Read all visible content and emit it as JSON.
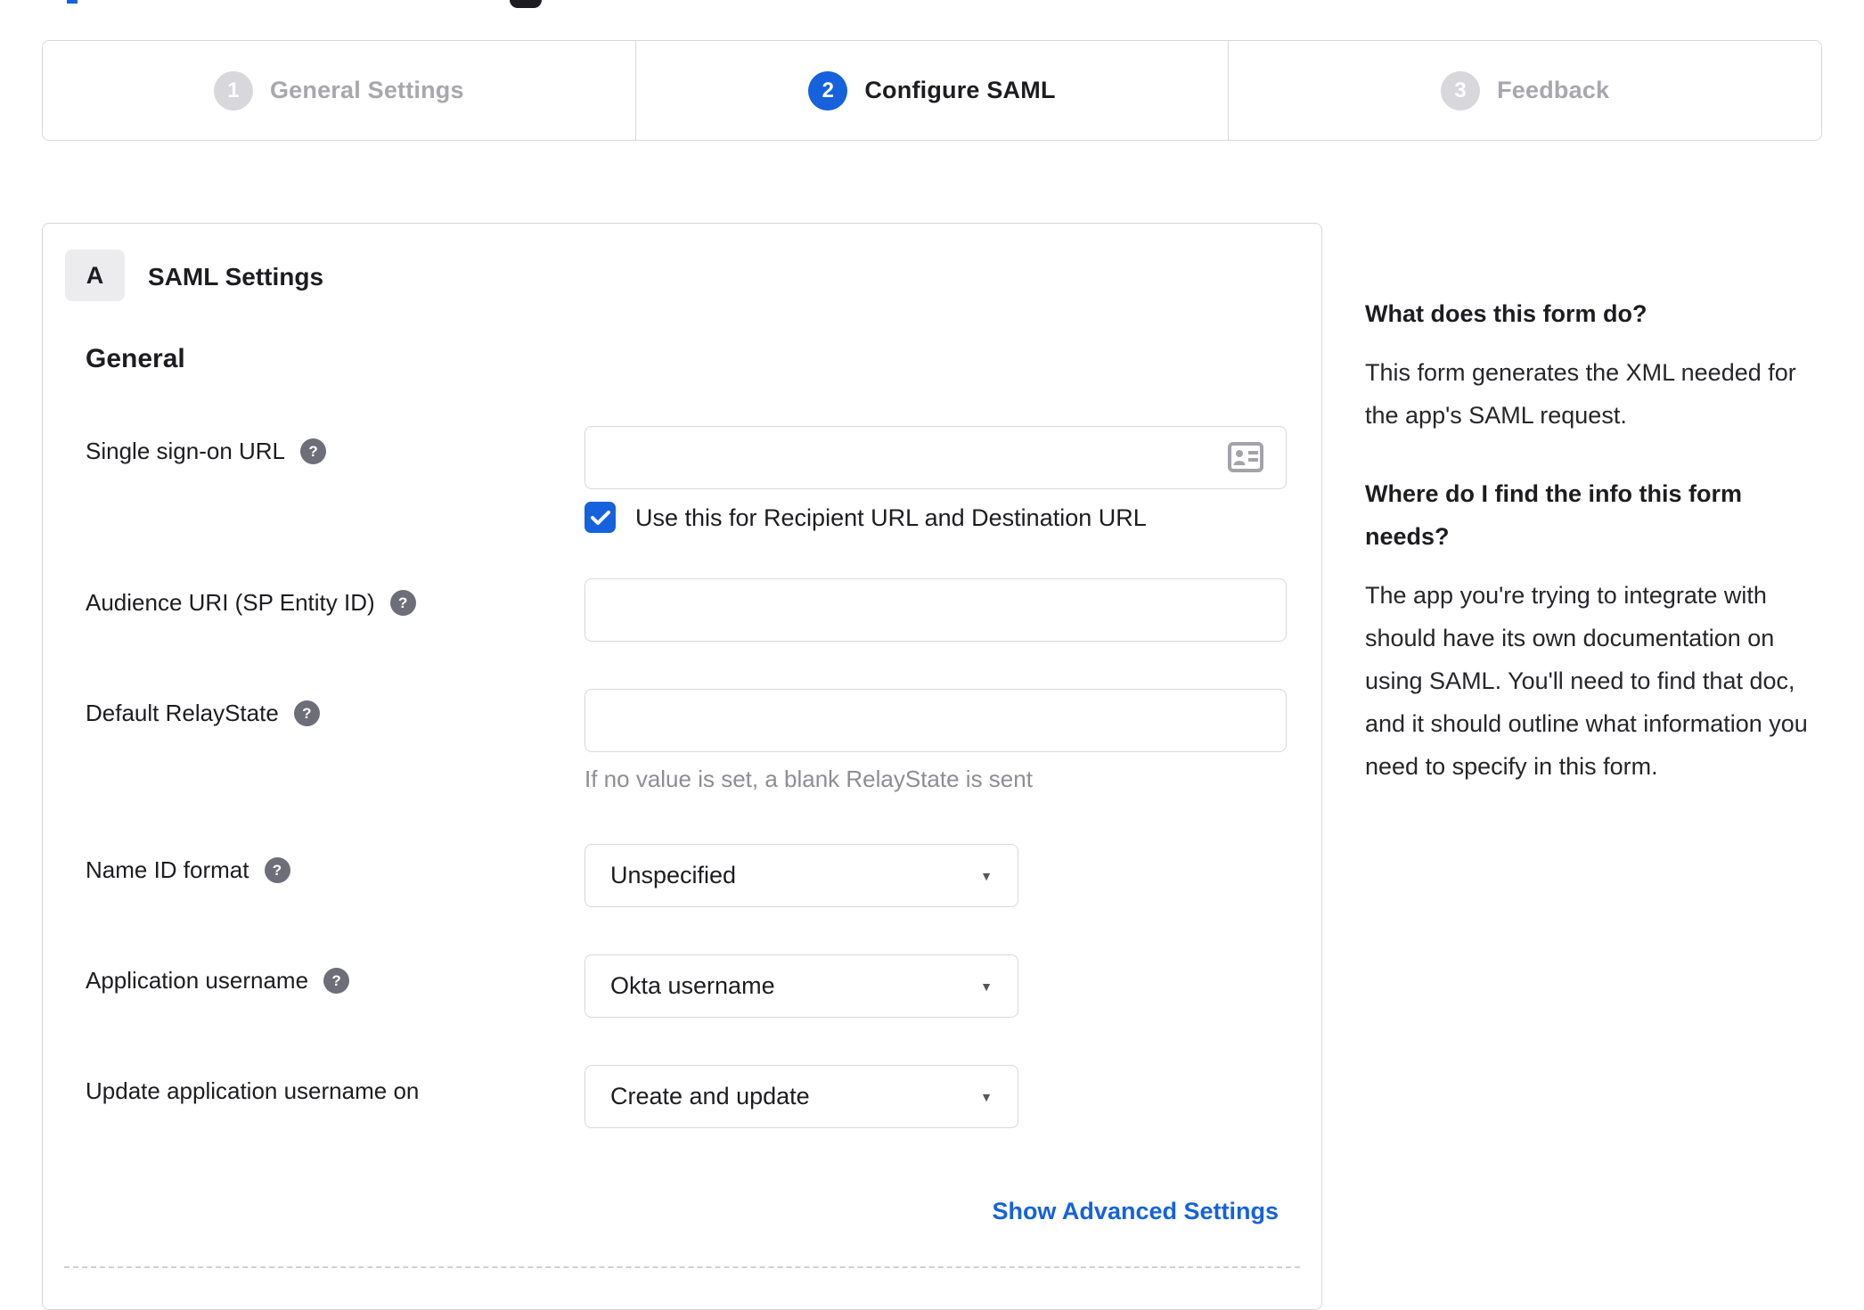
{
  "colors": {
    "accent_blue": "#1662dd",
    "inactive_gray": "#d7d7dc",
    "border_gray": "#d8d8dc",
    "help_icon_gray": "#6e6e78"
  },
  "icons": {
    "help_glyph": "?",
    "dropdown_caret_glyph": "▼"
  },
  "stepper": {
    "steps": [
      {
        "number": "1",
        "label": "General Settings",
        "state": "inactive"
      },
      {
        "number": "2",
        "label": "Configure SAML",
        "state": "active"
      },
      {
        "number": "3",
        "label": "Feedback",
        "state": "inactive"
      }
    ]
  },
  "panel": {
    "section_badge": "A",
    "section_title": "SAML Settings",
    "group_heading": "General",
    "form": {
      "sso": {
        "label": "Single sign-on URL",
        "value": "",
        "checkbox_label": "Use this for Recipient URL and Destination URL",
        "checkbox_checked": true
      },
      "audience": {
        "label": "Audience URI (SP Entity ID)",
        "value": ""
      },
      "relay_state": {
        "label": "Default RelayState",
        "value": "",
        "hint": "If no value is set, a blank RelayState is sent"
      },
      "name_id_format": {
        "label": "Name ID format",
        "value": "Unspecified"
      },
      "app_username": {
        "label": "Application username",
        "value": "Okta username"
      },
      "update_app_username": {
        "label": "Update application username on",
        "value": "Create and update"
      },
      "advanced_link": "Show Advanced Settings"
    }
  },
  "help": {
    "q1": "What does this form do?",
    "a1": "This form generates the XML needed for the app's SAML request.",
    "q2": "Where do I find the info this form needs?",
    "a2": "The app you're trying to integrate with should have its own documentation on using SAML. You'll need to find that doc, and it should outline what information you need to specify in this form."
  }
}
